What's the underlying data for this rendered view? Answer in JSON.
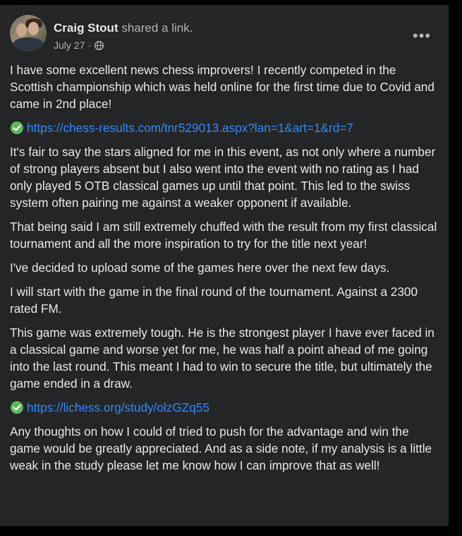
{
  "post": {
    "author": "Craig Stout",
    "action": "shared a link.",
    "date": "July 27",
    "separator": "·",
    "privacy_icon": "globe-icon",
    "more_icon": "more-options-icon",
    "more_label": "•••",
    "paragraphs": [
      "I have some excellent news chess improvers! I recently competed in the Scottish championship which was held online for the first time due to Covid and came in 2nd place!",
      "It's fair to say the stars aligned for me in this event, as not only where a number of strong players absent but I also went into the event with no rating as I had only played 5 OTB classical games up until that point. This led to the swiss system often pairing me against a weaker opponent if available.",
      "That being said I am still extremely chuffed with the result from my first classical tournament and all the more inspiration to try for the title next year!",
      "I've decided to upload some of the games here over the next few days.",
      "I will start with the game in the final round of the tournament. Against a 2300 rated FM.",
      "This game was extremely tough. He is the strongest player I have ever faced in a classical game and worse yet for me, he was half a point ahead of me going into the last round. This meant I had to win to secure the title, but ultimately the game ended in a draw.",
      "Any thoughts on how I could of tried to push for the advantage and win the game would be greatly appreciated. And as a side note, if my analysis is a little weak in the study please let me know how I can improve that as well!"
    ],
    "links": [
      "https://chess-results.com/tnr529013.aspx?lan=1&art=1&rd=7",
      "https://lichess.org/study/olzGZq55"
    ],
    "link_icon": "check-mark-icon",
    "colors": {
      "background": "#242526",
      "text": "#e4e6eb",
      "secondary_text": "#b0b3b8",
      "link": "#2d88ff",
      "check_green": "#5cb85c"
    }
  }
}
